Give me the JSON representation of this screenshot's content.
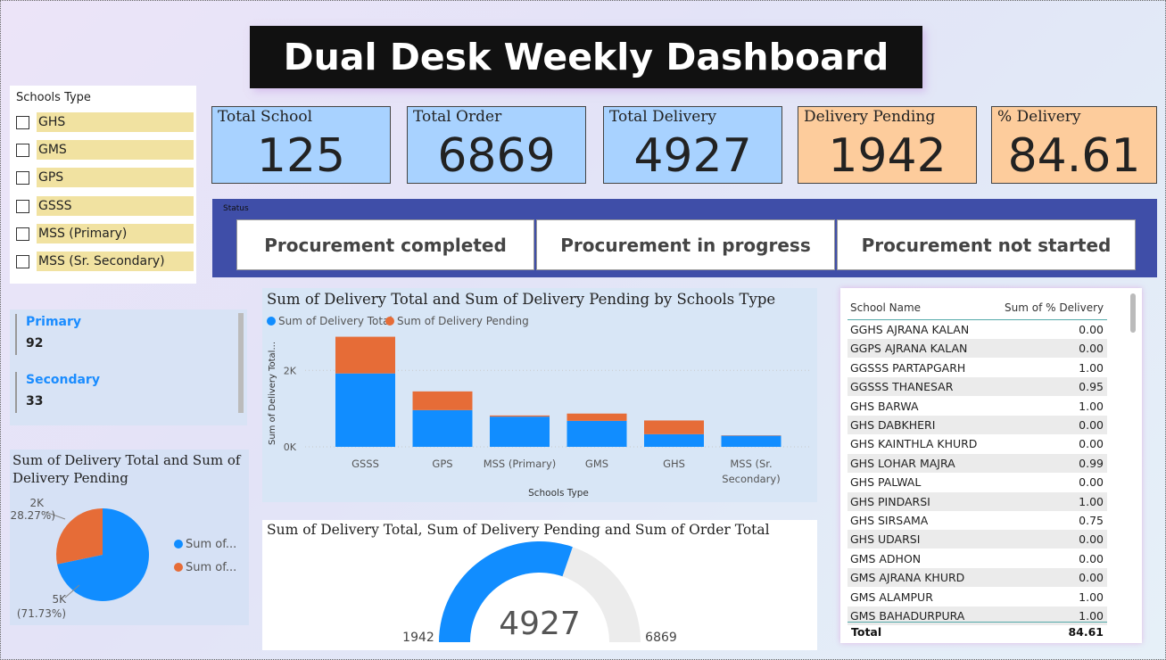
{
  "title": "Dual Desk Weekly Dashboard",
  "slicer": {
    "title": "Schools Type",
    "items": [
      "GHS",
      "GMS",
      "GPS",
      "GSSS",
      "MSS (Primary)",
      "MSS (Sr. Secondary)"
    ]
  },
  "kpis": [
    {
      "label": "Total School",
      "value": "125"
    },
    {
      "label": "Total Order",
      "value": "6869"
    },
    {
      "label": "Total Delivery",
      "value": "4927"
    },
    {
      "label": "Delivery Pending",
      "value": "1942"
    },
    {
      "label": "% Delivery",
      "value": "84.61"
    }
  ],
  "colors": {
    "blue_card": "#a8d2ff",
    "orange_card": "#fdcc9c",
    "series_total": "#118dff",
    "series_pending": "#e66c37",
    "status_bg": "#3f4ea8"
  },
  "status": {
    "label": "Status",
    "buttons": [
      "Procurement completed",
      "Procurement in progress",
      "Procurement not started"
    ]
  },
  "multi_card": [
    {
      "label": "Primary",
      "value": "92"
    },
    {
      "label": "Secondary",
      "value": "33"
    }
  ],
  "pie": {
    "title": "Sum of Delivery Total and Sum of Delivery Pending",
    "labels": {
      "pending": "2K",
      "pending_pct": "(28.27%)",
      "total": "5K",
      "total_pct": "(71.73%)"
    },
    "legend": [
      "Sum of...",
      "Sum of..."
    ]
  },
  "bar_chart": {
    "title": "Sum of Delivery Total and Sum of Delivery Pending by Schools Type",
    "legend": [
      "Sum of Delivery Total",
      "Sum of Delivery Pending"
    ],
    "ylabel": "Sum of Delivery Total...",
    "xlabel": "Schools Type",
    "yticks": [
      "2K",
      "0K"
    ]
  },
  "gauge": {
    "title": "Sum of Delivery Total, Sum of Delivery Pending and Sum of Order Total",
    "value": "4927",
    "min": "1942",
    "max": "6869"
  },
  "table": {
    "headers": [
      "School Name",
      "Sum of % Delivery"
    ],
    "rows": [
      [
        "GGHS AJRANA KALAN",
        "0.00"
      ],
      [
        "GGPS AJRANA KALAN",
        "0.00"
      ],
      [
        "GGSSS PARTAPGARH",
        "1.00"
      ],
      [
        "GGSSS THANESAR",
        "0.95"
      ],
      [
        "GHS BARWA",
        "1.00"
      ],
      [
        "GHS DABKHERI",
        "0.00"
      ],
      [
        "GHS KAINTHLA KHURD",
        "0.00"
      ],
      [
        "GHS LOHAR MAJRA",
        "0.99"
      ],
      [
        "GHS PALWAL",
        "0.00"
      ],
      [
        "GHS PINDARSI",
        "1.00"
      ],
      [
        "GHS SIRSAMA",
        "0.75"
      ],
      [
        "GHS UDARSI",
        "0.00"
      ],
      [
        "GMS ADHON",
        "0.00"
      ],
      [
        "GMS AJRANA KHURD",
        "0.00"
      ],
      [
        "GMS ALAMPUR",
        "1.00"
      ],
      [
        "GMS BAHADURPURA",
        "1.00"
      ]
    ],
    "total_label": "Total",
    "total_value": "84.61"
  },
  "chart_data": [
    {
      "type": "bar",
      "stacked": true,
      "title": "Sum of Delivery Total and Sum of Delivery Pending by Schools Type",
      "categories": [
        "GSSS",
        "GPS",
        "MSS (Primary)",
        "GMS",
        "GHS",
        "MSS (Sr. Secondary)"
      ],
      "series": [
        {
          "name": "Sum of Delivery Total",
          "values": [
            1920,
            960,
            790,
            680,
            330,
            290
          ]
        },
        {
          "name": "Sum of Delivery Pending",
          "values": [
            960,
            490,
            30,
            190,
            360,
            10
          ]
        }
      ],
      "xlabel": "Schools Type",
      "ylabel": "Sum of Delivery Total...",
      "ylim": [
        0,
        3500
      ],
      "grid": true,
      "legend": "top-left"
    },
    {
      "type": "pie",
      "title": "Sum of Delivery Total and Sum of Delivery Pending",
      "categories": [
        "Sum of...",
        "Sum of..."
      ],
      "values": [
        4927,
        1942
      ],
      "percent": [
        71.73,
        28.27
      ]
    },
    {
      "type": "gauge",
      "title": "Sum of Delivery Total, Sum of Delivery Pending and Sum of Order Total",
      "value": 4927,
      "min": 1942,
      "max": 6869
    }
  ]
}
